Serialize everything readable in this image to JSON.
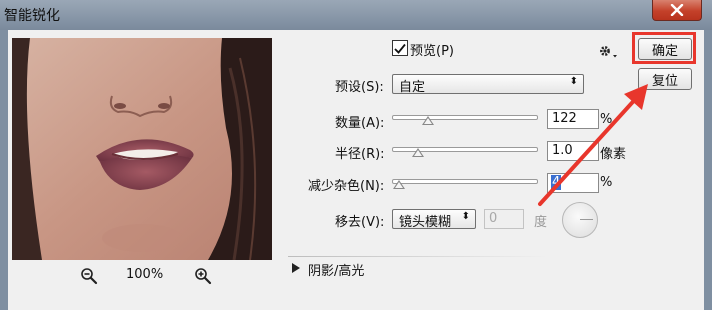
{
  "window": {
    "title": "智能锐化",
    "close_icon": "close-icon"
  },
  "preview": {
    "zoom": "100%",
    "zoom_out_icon": "zoom-out-icon",
    "zoom_in_icon": "zoom-in-icon"
  },
  "options": {
    "preview_label": "预览(P)",
    "preview_checked": true,
    "settings_icon": "gear-icon"
  },
  "preset": {
    "label": "预设(S):",
    "value": "自定"
  },
  "amount": {
    "label": "数量(A):",
    "value": "122",
    "unit": "%",
    "fraction": 0.24
  },
  "radius": {
    "label": "半径(R):",
    "value": "1.0",
    "unit": "像素",
    "fraction": 0.17
  },
  "noise": {
    "label": "减少杂色(N):",
    "value": "4",
    "unit": "%",
    "fraction": 0.04
  },
  "remove": {
    "label": "移去(V):",
    "value": "镜头模糊",
    "angle_value": "0",
    "angle_unit": "度"
  },
  "shadows": {
    "label": "阴影/高光",
    "expand_icon": "triangle-right-icon"
  },
  "buttons": {
    "ok": "确定",
    "reset": "复位"
  },
  "annotation": {
    "color": "#e8362c"
  }
}
